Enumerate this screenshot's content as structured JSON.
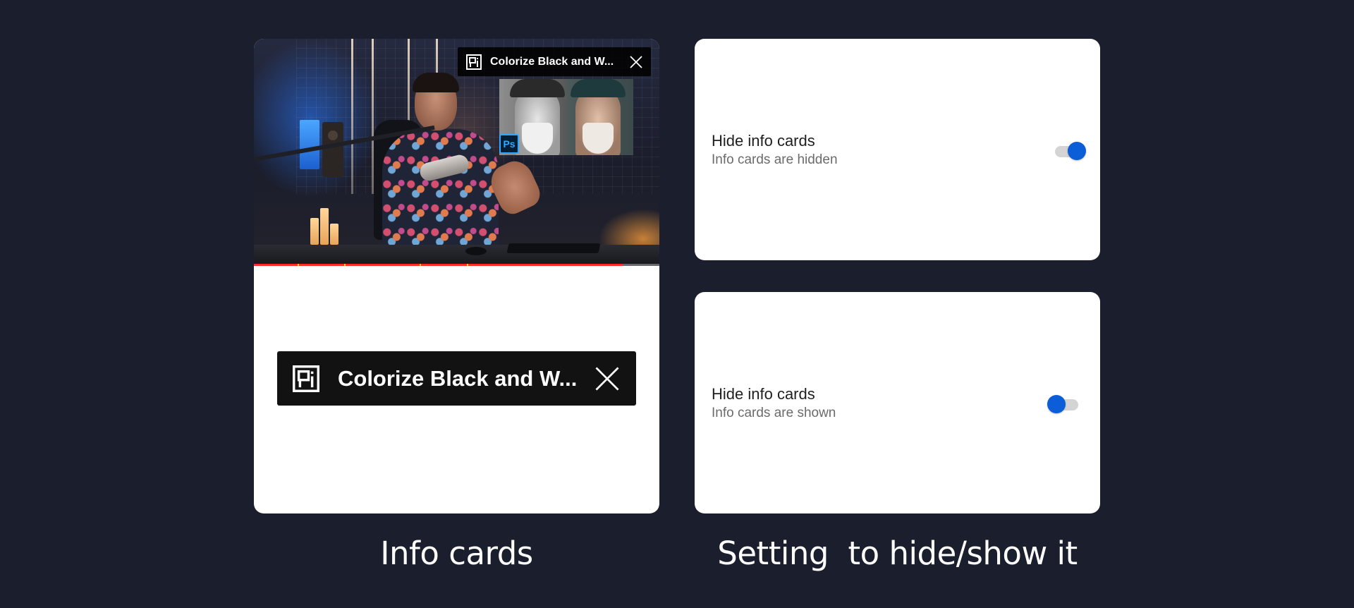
{
  "info_card_preview": {
    "card_title": "Colorize Black and W...",
    "thumbnail_badge": "Ps",
    "progress_fraction": 0.91
  },
  "settings": [
    {
      "title": "Hide info cards",
      "subtitle": "Info cards are hidden",
      "toggle_on": true
    },
    {
      "title": "Hide info cards",
      "subtitle": "Info cards are shown",
      "toggle_on": false
    }
  ],
  "captions": {
    "left": "Info cards",
    "right": "Setting  to hide/show it"
  },
  "colors": {
    "background": "#1b1f2d",
    "toggle_accent": "#0b5ed7",
    "progress": "#ff2a2a"
  }
}
